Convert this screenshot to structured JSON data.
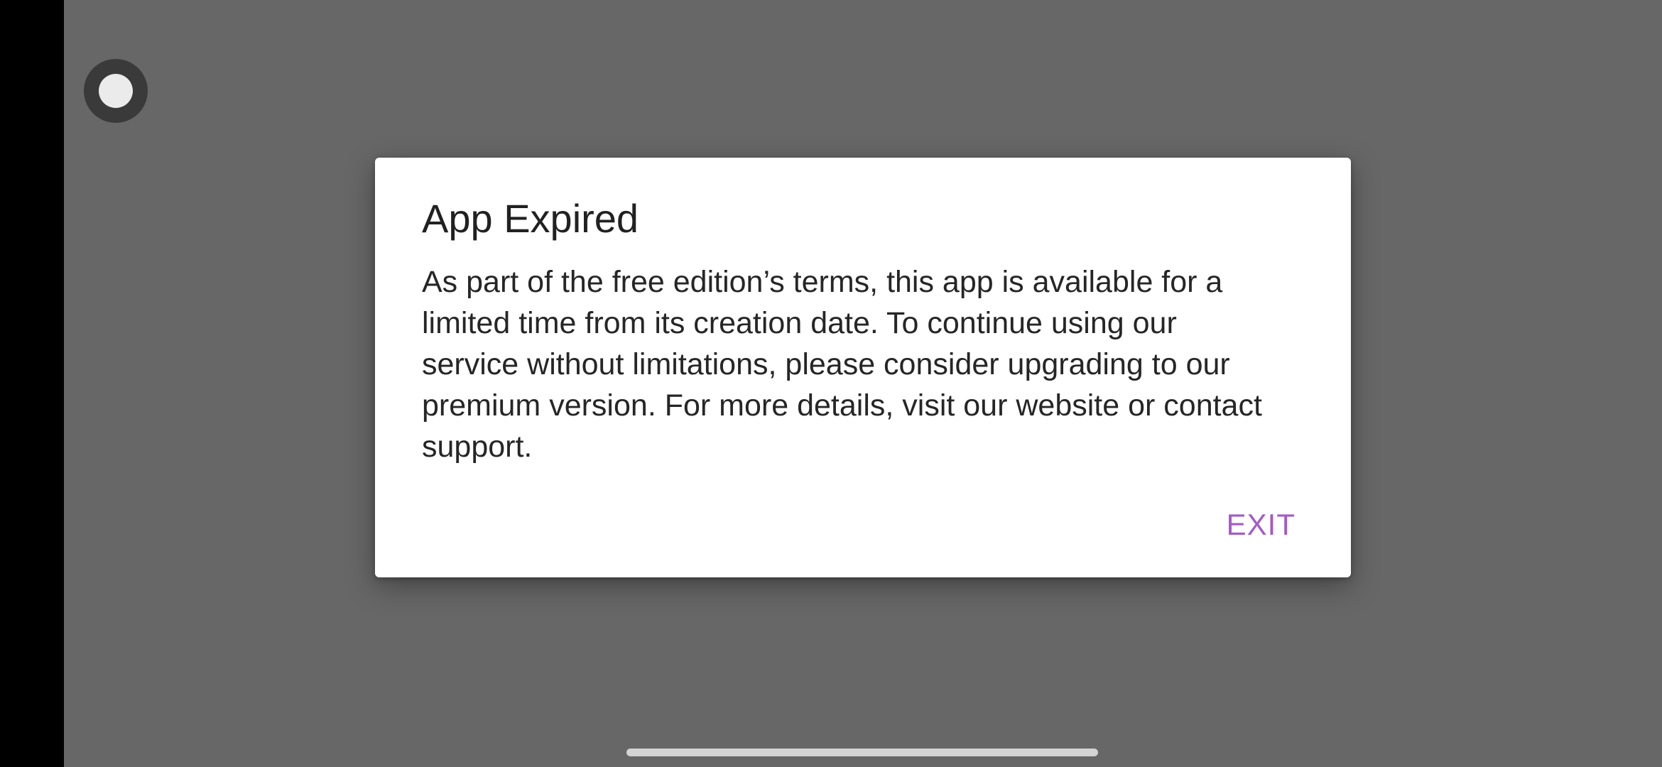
{
  "dialog": {
    "title": "App Expired",
    "message": "As part of the free edition’s terms, this app is available for a limited time from its creation date. To continue using our service without limitations, please consider upgrading to our premium version. For more details, visit our website or contact support.",
    "exit_label": "EXIT"
  },
  "colors": {
    "scrim": "#676767",
    "dialog_background": "#ffffff",
    "accent": "#a45ac8",
    "text": "#262626"
  },
  "icons": {
    "floating_button": "record-circle-icon"
  }
}
